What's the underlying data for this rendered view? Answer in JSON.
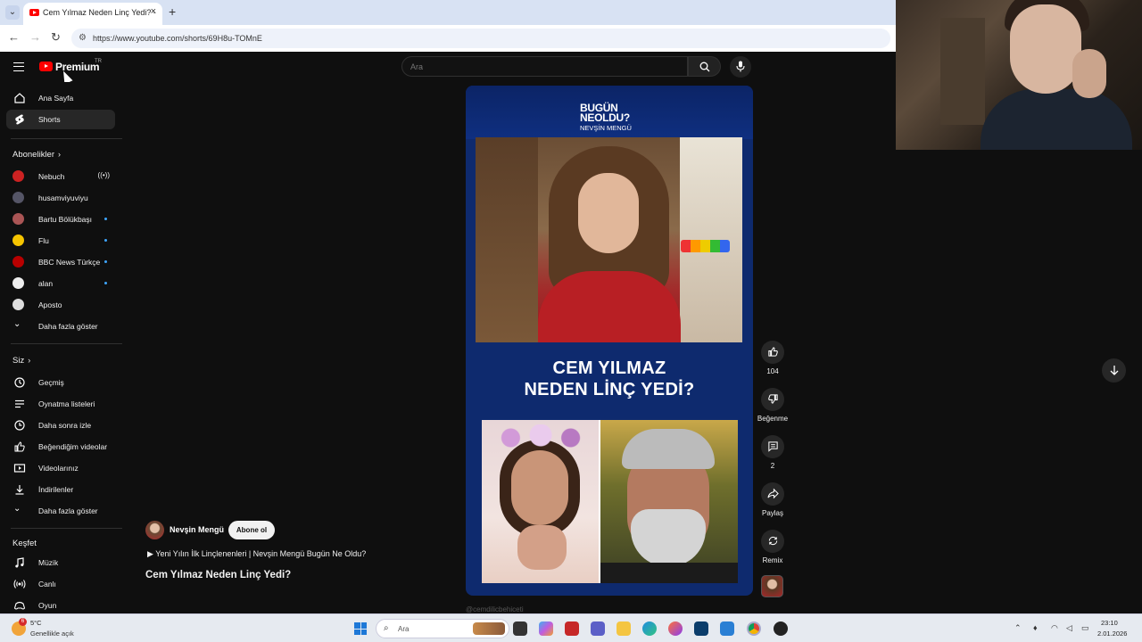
{
  "browser": {
    "tab_title": "Cem Yılmaz Neden Linç Yedi? -",
    "url": "https://www.youtube.com/shorts/69H8u-TOMnE"
  },
  "header": {
    "logo_text": "Premium",
    "country_code": "TR",
    "search_placeholder": "Ara"
  },
  "sidebar": {
    "main": [
      {
        "label": "Ana Sayfa",
        "icon": "home-icon"
      },
      {
        "label": "Shorts",
        "icon": "shorts-icon"
      }
    ],
    "subscriptions_title": "Abonelikler",
    "subscriptions": [
      {
        "label": "Nebuch",
        "live": true
      },
      {
        "label": "husamviyuviyu",
        "dot": false
      },
      {
        "label": "Bartu Bölükbaşı",
        "dot": true
      },
      {
        "label": "Flu",
        "dot": true
      },
      {
        "label": "BBC News Türkçe",
        "dot": true
      },
      {
        "label": "alan",
        "dot": true
      },
      {
        "label": "Aposto",
        "dot": false
      }
    ],
    "show_more_1": "Daha fazla göster",
    "you_title": "Siz",
    "you": [
      {
        "label": "Geçmiş",
        "icon": "history-icon"
      },
      {
        "label": "Oynatma listeleri",
        "icon": "playlists-icon"
      },
      {
        "label": "Daha sonra izle",
        "icon": "watch-later-icon"
      },
      {
        "label": "Beğendiğim videolar",
        "icon": "liked-icon"
      },
      {
        "label": "Videolarınız",
        "icon": "your-videos-icon"
      },
      {
        "label": "İndirilenler",
        "icon": "downloads-icon"
      }
    ],
    "show_more_2": "Daha fazla göster",
    "explore_title": "Keşfet",
    "explore": [
      {
        "label": "Müzik",
        "icon": "music-icon"
      },
      {
        "label": "Canlı",
        "icon": "live-icon"
      },
      {
        "label": "Oyun",
        "icon": "gaming-icon"
      }
    ]
  },
  "video": {
    "brand_line1": "BUGÜN",
    "brand_line2": "NEOLDU?",
    "brand_sub": "NEVŞİN MENGÜ",
    "headline_line1": "CEM YILMAZ",
    "headline_line2": "NEDEN LİNÇ YEDİ?",
    "channel_name": "Nevşin Mengü",
    "subscribe_label": "Abone ol",
    "playlist_text": "Yeni Yılın İlk Linçlenenleri | Nevşin Mengü Bugün Ne Oldu?",
    "title": "Cem Yılmaz Neden Linç Yedi?",
    "bottom_handle": "@cemdilicbehiceti"
  },
  "actions": {
    "like_count": "104",
    "dislike_label": "Beğenme",
    "comment_count": "2",
    "share_label": "Paylaş",
    "remix_label": "Remix"
  },
  "taskbar": {
    "temperature": "5°C",
    "weather": "Genellikle açık",
    "weather_badge": "6",
    "search_text": "Ara",
    "time": "23:10",
    "date": "2.01.2026"
  },
  "colors": {
    "youtube_red": "#ff0000",
    "accent_blue": "#3ea6ff",
    "page_bg": "#0f0f0f"
  }
}
